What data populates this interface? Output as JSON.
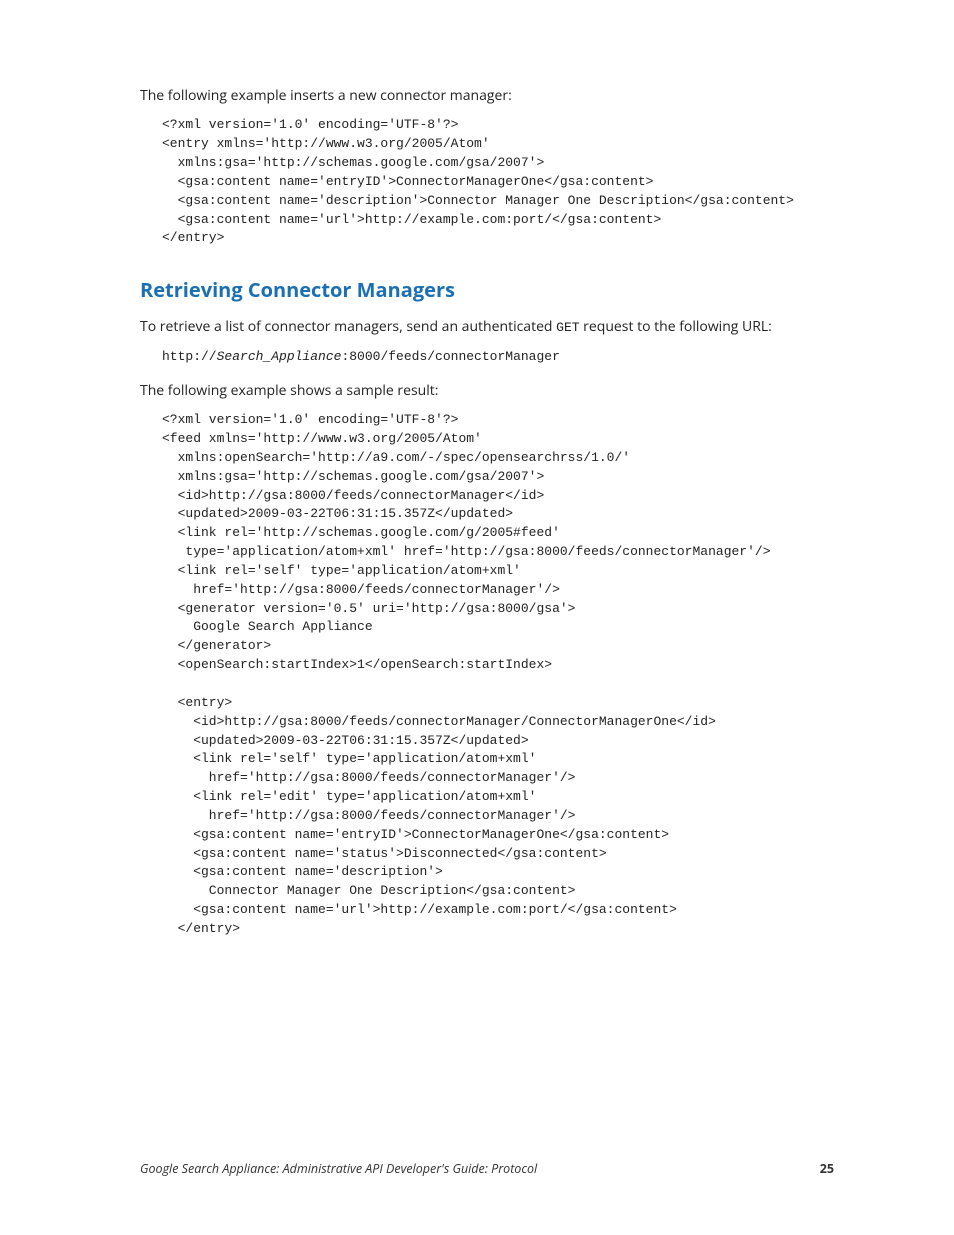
{
  "intro_para": "The following example inserts a new connector manager:",
  "code_insert": "<?xml version='1.0' encoding='UTF-8'?>\n<entry xmlns='http://www.w3.org/2005/Atom'\n  xmlns:gsa='http://schemas.google.com/gsa/2007'>\n  <gsa:content name='entryID'>ConnectorManagerOne</gsa:content>\n  <gsa:content name='description'>Connector Manager One Description</gsa:content>\n  <gsa:content name='url'>http://example.com:port/</gsa:content>\n</entry>",
  "section_heading": "Retrieving Connector Managers",
  "retrieve_para_pre": "To retrieve a list of connector managers, send an authenticated ",
  "retrieve_para_code": "GET",
  "retrieve_para_post": " request to the following URL:",
  "code_url_pre": "http://",
  "code_url_italic": "Search_Appliance",
  "code_url_post": ":8000/feeds/connectorManager",
  "sample_para": "The following example shows a sample result:",
  "code_sample": "<?xml version='1.0' encoding='UTF-8'?>\n<feed xmlns='http://www.w3.org/2005/Atom'\n  xmlns:openSearch='http://a9.com/-/spec/opensearchrss/1.0/'\n  xmlns:gsa='http://schemas.google.com/gsa/2007'>\n  <id>http://gsa:8000/feeds/connectorManager</id>\n  <updated>2009-03-22T06:31:15.357Z</updated>\n  <link rel='http://schemas.google.com/g/2005#feed'\n   type='application/atom+xml' href='http://gsa:8000/feeds/connectorManager'/>\n  <link rel='self' type='application/atom+xml'\n    href='http://gsa:8000/feeds/connectorManager'/>\n  <generator version='0.5' uri='http://gsa:8000/gsa'>\n    Google Search Appliance\n  </generator>\n  <openSearch:startIndex>1</openSearch:startIndex>\n\n  <entry>\n    <id>http://gsa:8000/feeds/connectorManager/ConnectorManagerOne</id>\n    <updated>2009-03-22T06:31:15.357Z</updated>\n    <link rel='self' type='application/atom+xml'\n      href='http://gsa:8000/feeds/connectorManager'/>\n    <link rel='edit' type='application/atom+xml'\n      href='http://gsa:8000/feeds/connectorManager'/>\n    <gsa:content name='entryID'>ConnectorManagerOne</gsa:content>\n    <gsa:content name='status'>Disconnected</gsa:content>\n    <gsa:content name='description'>\n      Connector Manager One Description</gsa:content>\n    <gsa:content name='url'>http://example.com:port/</gsa:content>\n  </entry>",
  "footer_text": "Google Search Appliance: Administrative API Developer's Guide: Protocol",
  "page_number": "25"
}
